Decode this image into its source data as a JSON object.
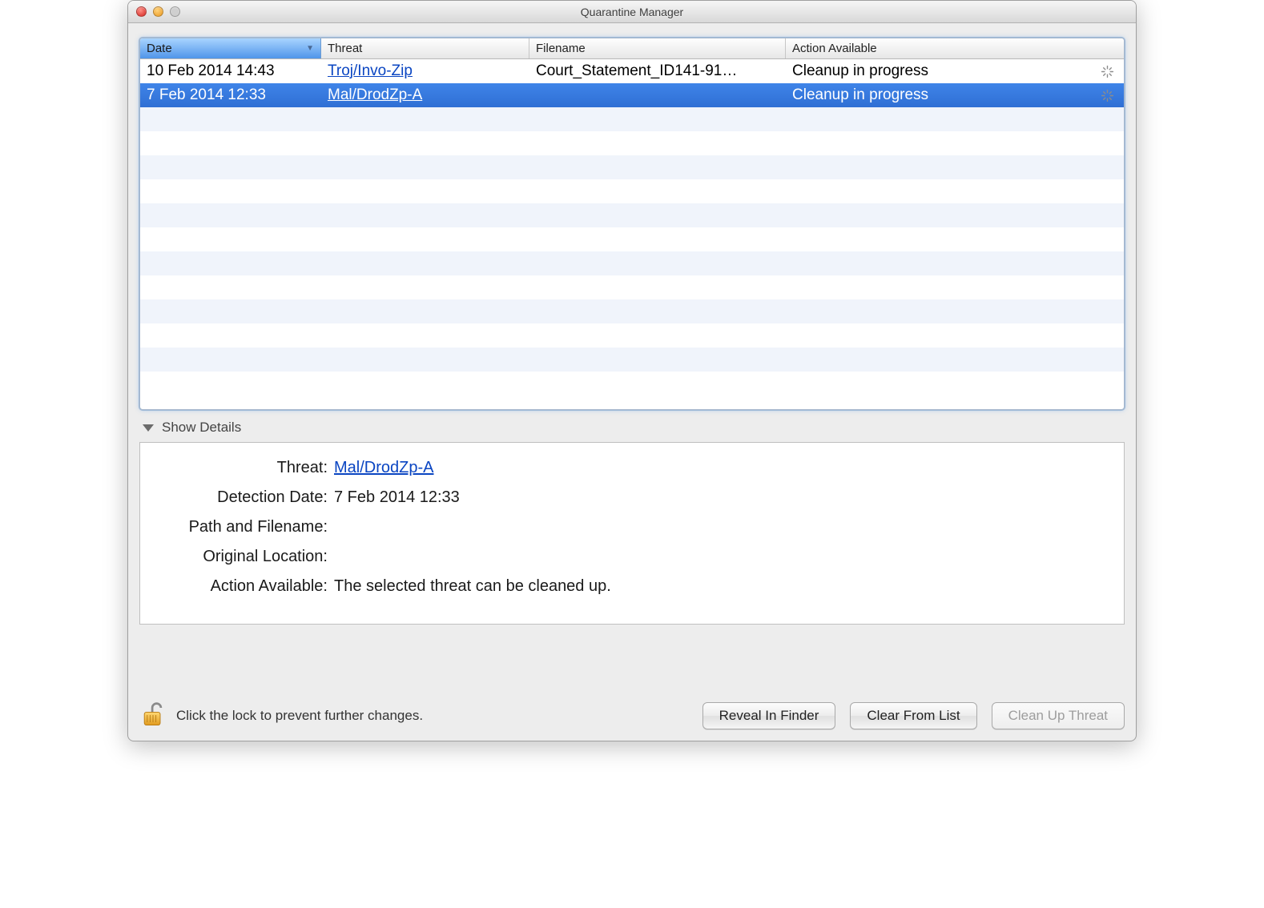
{
  "window": {
    "title": "Quarantine Manager"
  },
  "table": {
    "columns": {
      "date": "Date",
      "threat": "Threat",
      "filename": "Filename",
      "action": "Action Available"
    },
    "rows": [
      {
        "date": "10 Feb 2014 14:43",
        "threat": "Troj/Invo-Zip",
        "filename": "Court_Statement_ID141-91…",
        "action": "Cleanup in progress",
        "selected": false
      },
      {
        "date": "7 Feb 2014 12:33",
        "threat": "Mal/DrodZp-A",
        "filename": "",
        "action": "Cleanup in progress",
        "selected": true
      }
    ]
  },
  "disclosure": {
    "label": "Show Details"
  },
  "details": {
    "labels": {
      "threat": "Threat:",
      "detection_date": "Detection Date:",
      "path_filename": "Path and Filename:",
      "original_location": "Original Location:",
      "action_available": "Action Available:"
    },
    "values": {
      "threat": "Mal/DrodZp-A",
      "detection_date": "7 Feb 2014 12:33",
      "path_filename": "",
      "original_location": "",
      "action_available": "The selected threat can be cleaned up."
    }
  },
  "footer": {
    "lock_text": "Click the lock to prevent further changes.",
    "buttons": {
      "reveal": "Reveal In Finder",
      "clear": "Clear From List",
      "cleanup": "Clean Up Threat"
    }
  }
}
